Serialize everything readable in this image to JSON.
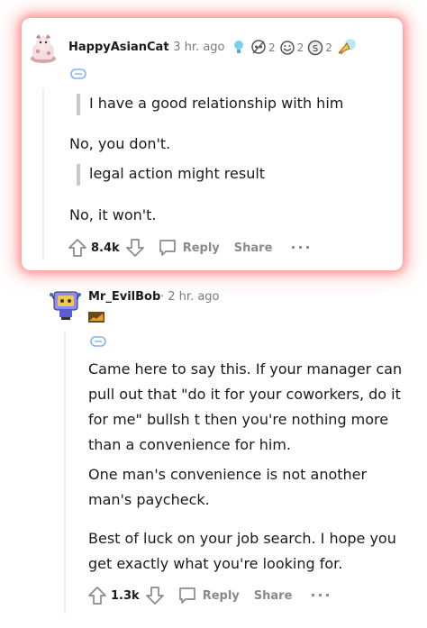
{
  "comment1": {
    "username": "HappyAsianCat",
    "time": "· 3 hr. ago",
    "awards": [
      {
        "icon": "lightbulb-award-icon",
        "count": ""
      },
      {
        "icon": "skull-award-icon",
        "count": "2"
      },
      {
        "icon": "laugh-award-icon",
        "count": "2"
      },
      {
        "icon": "silver-award-icon",
        "count": "2"
      },
      {
        "icon": "rocket-award-icon",
        "count": ""
      }
    ],
    "quote1": "I have a good relationship with him",
    "reply1": "No, you don't.",
    "quote2": "legal action might result",
    "reply2": "No, it won't.",
    "score": "8.4k",
    "reply_label": "Reply",
    "share_label": "Share",
    "more": "···"
  },
  "comment2": {
    "username": "Mr_EvilBob",
    "time": "· 2 hr. ago",
    "flair_icon": "chart-flair-icon",
    "para1": "Came here to say this. If your manager can pull out that \"do it for your coworkers, do it for me\" bullsh t then you're nothing more than a convenience for him.",
    "para2": "One man's convenience is not another man's paycheck.",
    "para3": "Best of luck on your job search. I hope you get exactly what you're looking for.",
    "score": "1.3k",
    "reply_label": "Reply",
    "share_label": "Share",
    "more": "···"
  }
}
